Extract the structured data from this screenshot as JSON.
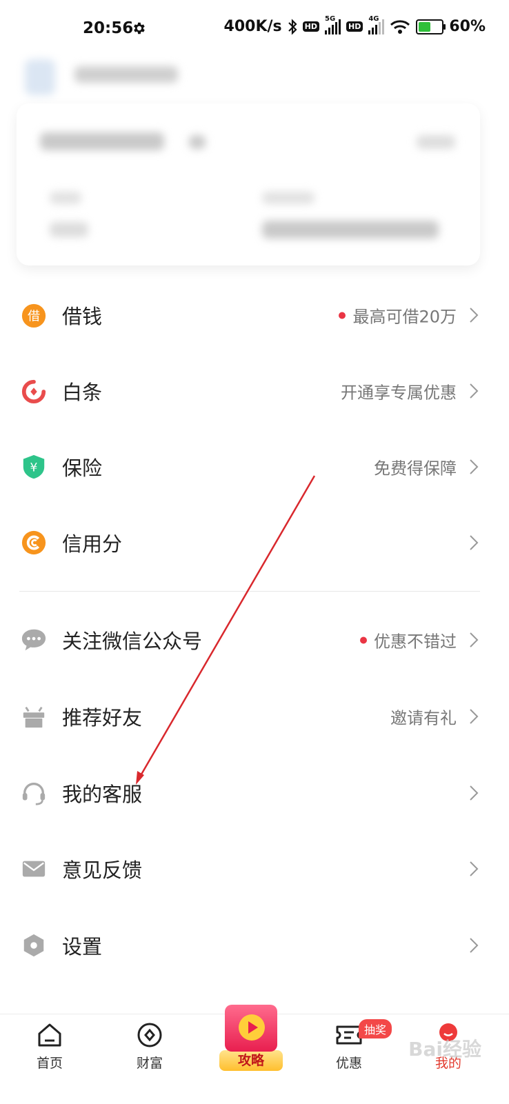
{
  "status_bar": {
    "time": "20:56",
    "net_speed": "400K/s",
    "sim1": {
      "hd": "HD",
      "net": "5G"
    },
    "sim2": {
      "hd": "HD",
      "net": "4G"
    },
    "battery": "60%",
    "battery_level": 0.6
  },
  "menu_group1": [
    {
      "label": "借钱",
      "hint": "最高可借20万",
      "dot": true,
      "icon": "borrow-icon",
      "color": "#f7941d"
    },
    {
      "label": "白条",
      "hint": "开通享专属优惠",
      "dot": false,
      "icon": "baitiao-icon",
      "color": "#e94c4c"
    },
    {
      "label": "保险",
      "hint": "免费得保障",
      "dot": false,
      "icon": "shield-yen-icon",
      "color": "#2ec48a"
    },
    {
      "label": "信用分",
      "hint": "",
      "dot": false,
      "icon": "credit-score-icon",
      "color": "#f7941d"
    }
  ],
  "menu_group2": [
    {
      "label": "关注微信公众号",
      "hint": "优惠不错过",
      "dot": true,
      "icon": "chat-bubble-icon"
    },
    {
      "label": "推荐好友",
      "hint": "邀请有礼",
      "dot": false,
      "icon": "gift-icon"
    },
    {
      "label": "我的客服",
      "hint": "",
      "dot": false,
      "icon": "headset-icon"
    },
    {
      "label": "意见反馈",
      "hint": "",
      "dot": false,
      "icon": "mail-icon"
    },
    {
      "label": "设置",
      "hint": "",
      "dot": false,
      "icon": "hexagon-settings-icon"
    }
  ],
  "tabbar": {
    "home": "首页",
    "wealth": "财富",
    "promo": "攻略",
    "deals": "优惠",
    "deals_badge": "抽奖",
    "mine": "我的"
  },
  "watermark": "Bai经验"
}
